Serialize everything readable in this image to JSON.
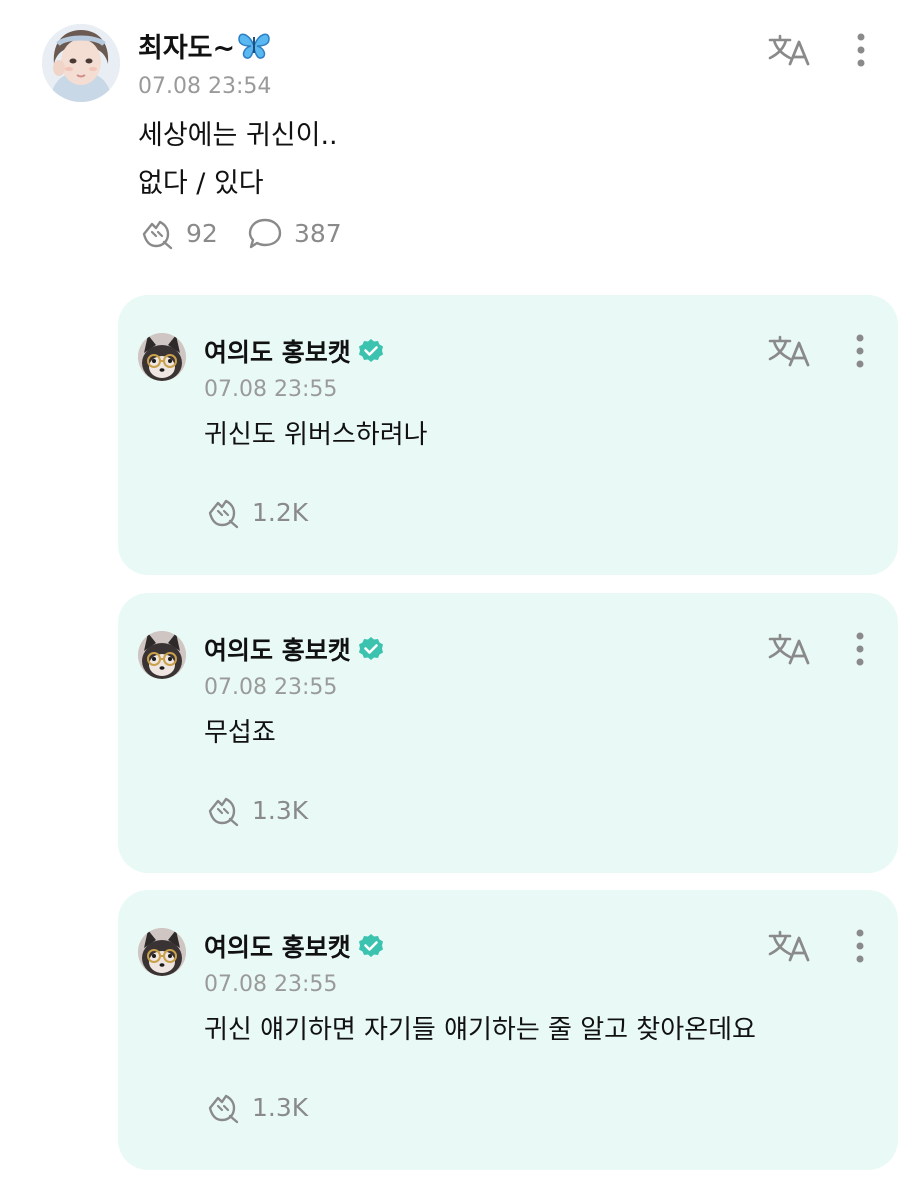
{
  "post": {
    "author": "최자도~",
    "author_emoji_icon": "butterfly-icon",
    "timestamp": "07.08 23:54",
    "lines": [
      "세상에는 귀신이..",
      "없다 / 있다"
    ],
    "reaction_count": "92",
    "comment_count": "387"
  },
  "replies": [
    {
      "author": "여의도 홍보캣",
      "verified": true,
      "timestamp": "07.08 23:55",
      "text": "귀신도 위버스하려나",
      "reaction_count": "1.2K"
    },
    {
      "author": "여의도 홍보캣",
      "verified": true,
      "timestamp": "07.08 23:55",
      "text": "무섭죠",
      "reaction_count": "1.3K"
    },
    {
      "author": "여의도 홍보캣",
      "verified": true,
      "timestamp": "07.08 23:55",
      "text": "귀신 얘기하면 자기들 얘기하는 줄 알고 찾아온데요",
      "reaction_count": "1.3K"
    }
  ],
  "colors": {
    "card_background": "#e9faf6",
    "verified_badge": "#3cc3b0",
    "meta_gray": "#9a9a9a",
    "icon_gray": "#8a8a8a"
  },
  "icons": [
    "translate-icon",
    "more-options-icon",
    "reaction-icon",
    "comment-icon",
    "verified-badge-icon"
  ]
}
